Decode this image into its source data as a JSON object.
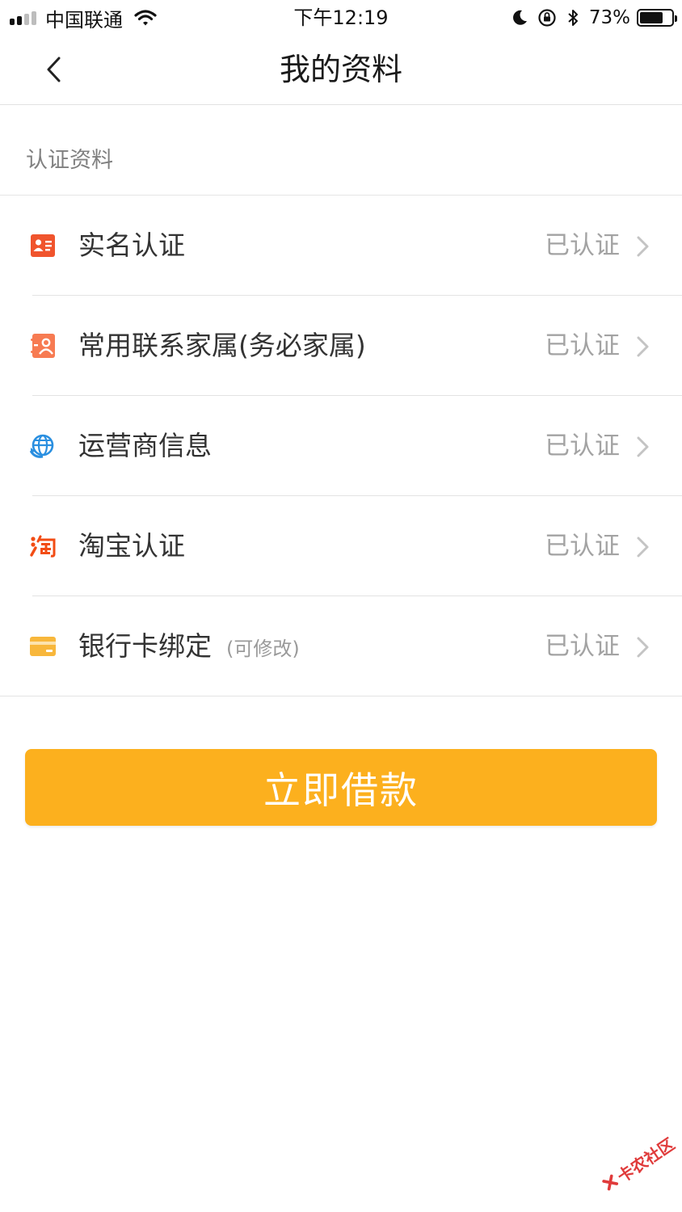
{
  "status_bar": {
    "carrier": "中国联通",
    "time": "下午12:19",
    "battery_percent": "73%",
    "battery_level": 0.73,
    "signal_bars_active": 2,
    "signal_bars_total": 4
  },
  "nav": {
    "title": "我的资料"
  },
  "section": {
    "title": "认证资料"
  },
  "rows": [
    {
      "label": "实名认证",
      "note": "",
      "status": "已认证",
      "icon": "id-card-icon",
      "icon_color": "#f0542d"
    },
    {
      "label": "常用联系家属(务必家属)",
      "note": "",
      "status": "已认证",
      "icon": "contacts-icon",
      "icon_color": "#f77b52"
    },
    {
      "label": "运营商信息",
      "note": "",
      "status": "已认证",
      "icon": "carrier-globe-icon",
      "icon_color": "#2a8fe0"
    },
    {
      "label": "淘宝认证",
      "note": "",
      "status": "已认证",
      "icon": "taobao-icon",
      "icon_color": "#f24c14"
    },
    {
      "label": "银行卡绑定",
      "note": "(可修改)",
      "status": "已认证",
      "icon": "bank-card-icon",
      "icon_color": "#f8b73b"
    }
  ],
  "action": {
    "loan_button": "立即借款",
    "button_color": "#fcb01e"
  },
  "watermark": {
    "text": "卡农社区"
  }
}
